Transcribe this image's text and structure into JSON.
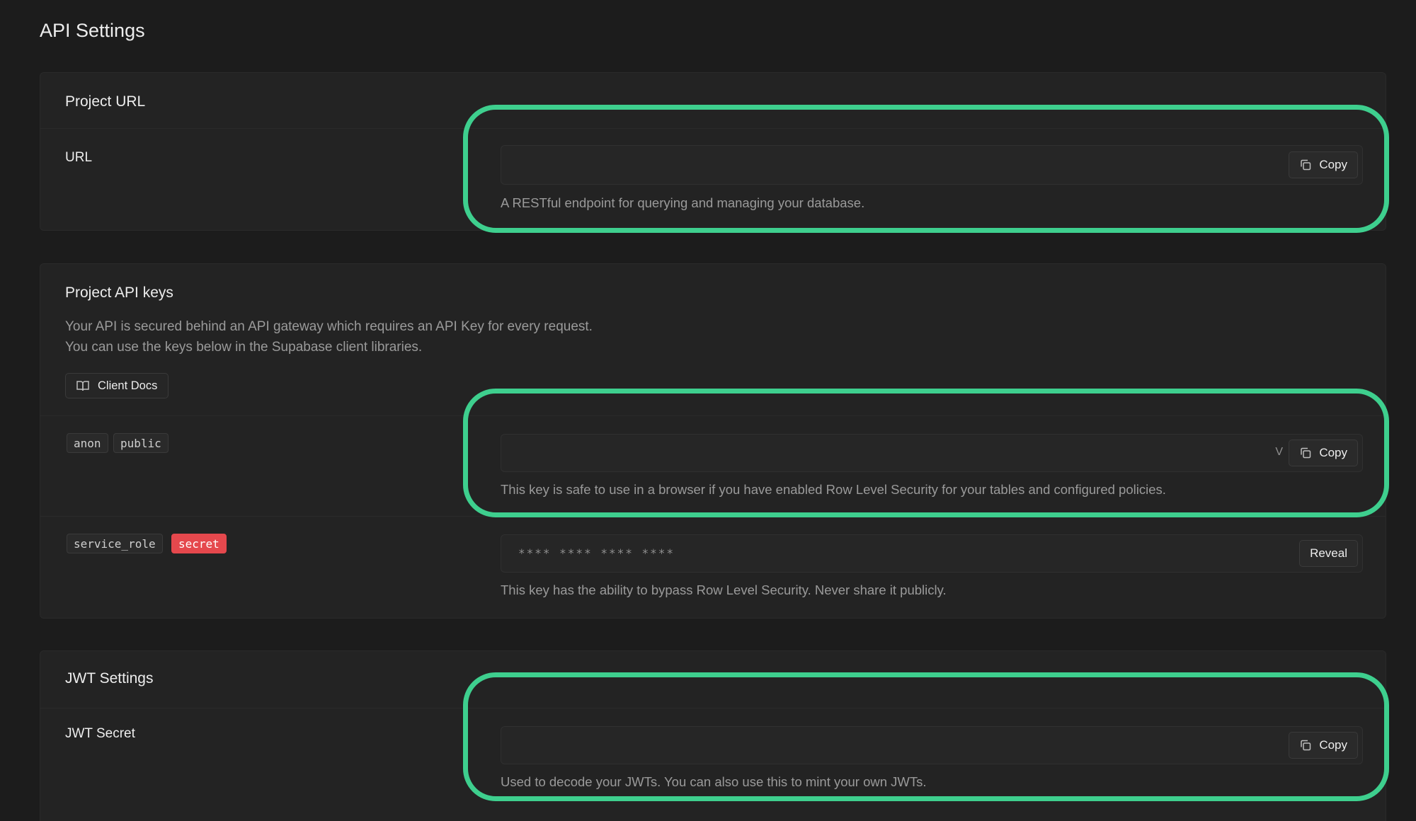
{
  "page": {
    "title": "API Settings"
  },
  "project_url": {
    "card_title": "Project URL",
    "label": "URL",
    "value": "",
    "copy_label": "Copy",
    "hint": "A RESTful endpoint for querying and managing your database."
  },
  "api_keys": {
    "card_title": "Project API keys",
    "description_line1": "Your API is secured behind an API gateway which requires an API Key for every request.",
    "description_line2": "You can use the keys below in the Supabase client libraries.",
    "docs_label": "Client Docs",
    "anon": {
      "tags": [
        "anon",
        "public"
      ],
      "value": "",
      "trailing_char": "V",
      "copy_label": "Copy",
      "hint": "This key is safe to use in a browser if you have enabled Row Level Security for your tables and configured policies."
    },
    "service_role": {
      "tags": [
        "service_role",
        "secret"
      ],
      "masked_value": "**** **** **** ****",
      "reveal_label": "Reveal",
      "hint": "This key has the ability to bypass Row Level Security. Never share it publicly."
    }
  },
  "jwt": {
    "card_title": "JWT Settings",
    "label": "JWT Secret",
    "value": "",
    "copy_label": "Copy",
    "hint": "Used to decode your JWTs. You can also use this to mint your own JWTs."
  },
  "colors": {
    "background": "#1c1c1c",
    "card": "#232323",
    "highlight": "#3ecf8e",
    "secret_tag": "#e5484d"
  },
  "icons": {
    "copy": "copy-icon",
    "docs": "book-open-icon"
  }
}
